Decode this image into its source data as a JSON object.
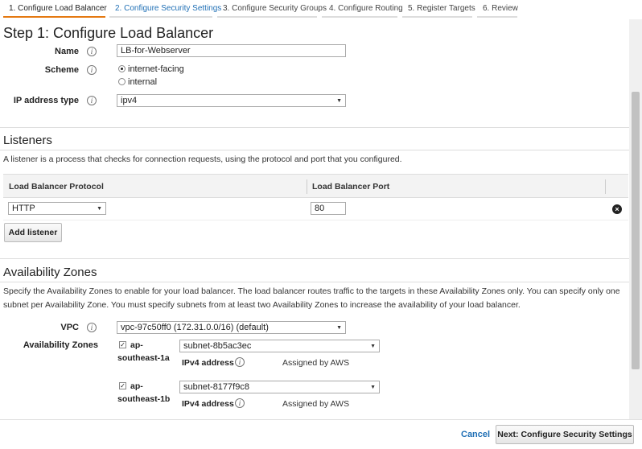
{
  "tabs": [
    {
      "label": "1. Configure Load Balancer",
      "active": true
    },
    {
      "label": "2. Configure Security Settings",
      "active": false
    },
    {
      "label": "3. Configure Security Groups",
      "active": false
    },
    {
      "label": "4. Configure Routing",
      "active": false
    },
    {
      "label": "5. Register Targets",
      "active": false
    },
    {
      "label": "6. Review",
      "active": false
    }
  ],
  "step_title": "Step 1: Configure Load Balancer",
  "basic": {
    "name_label": "Name",
    "name_value": "LB-for-Webserver",
    "scheme_label": "Scheme",
    "scheme_options": [
      {
        "label": "internet-facing",
        "checked": true
      },
      {
        "label": "internal",
        "checked": false
      }
    ],
    "ip_type_label": "IP address type",
    "ip_type_value": "ipv4"
  },
  "listeners": {
    "title": "Listeners",
    "description": "A listener is a process that checks for connection requests, using the protocol and port that you configured.",
    "col_protocol": "Load Balancer Protocol",
    "col_port": "Load Balancer Port",
    "rows": [
      {
        "protocol": "HTTP",
        "port": "80"
      }
    ],
    "add_button": "Add listener"
  },
  "availability": {
    "title": "Availability Zones",
    "description": "Specify the Availability Zones to enable for your load balancer. The load balancer routes traffic to the targets in these Availability Zones only. You can specify only one subnet per Availability Zone. You must specify subnets from at least two Availability Zones to increase the availability of your load balancer.",
    "vpc_label": "VPC",
    "vpc_value": "vpc-97c50ff0 (172.31.0.0/16) (default)",
    "zones_label": "Availability Zones",
    "zones": [
      {
        "name_line1": "ap-",
        "name_line2": "southeast-1a",
        "subnet": "subnet-8b5ac3ec",
        "ipv4_label": "IPv4 address",
        "ipv4_value": "Assigned by AWS",
        "checked": true
      },
      {
        "name_line1": "ap-",
        "name_line2": "southeast-1b",
        "subnet": "subnet-8177f9c8",
        "ipv4_label": "IPv4 address",
        "ipv4_value": "Assigned by AWS",
        "checked": true
      }
    ]
  },
  "footer": {
    "cancel": "Cancel",
    "next": "Next: Configure Security Settings"
  },
  "colors": {
    "active_tab_underline": "#e47911",
    "link": "#1f6fb5"
  },
  "icons": {
    "info": "info-icon",
    "remove": "close-icon",
    "caret": "chevron-down-icon"
  }
}
